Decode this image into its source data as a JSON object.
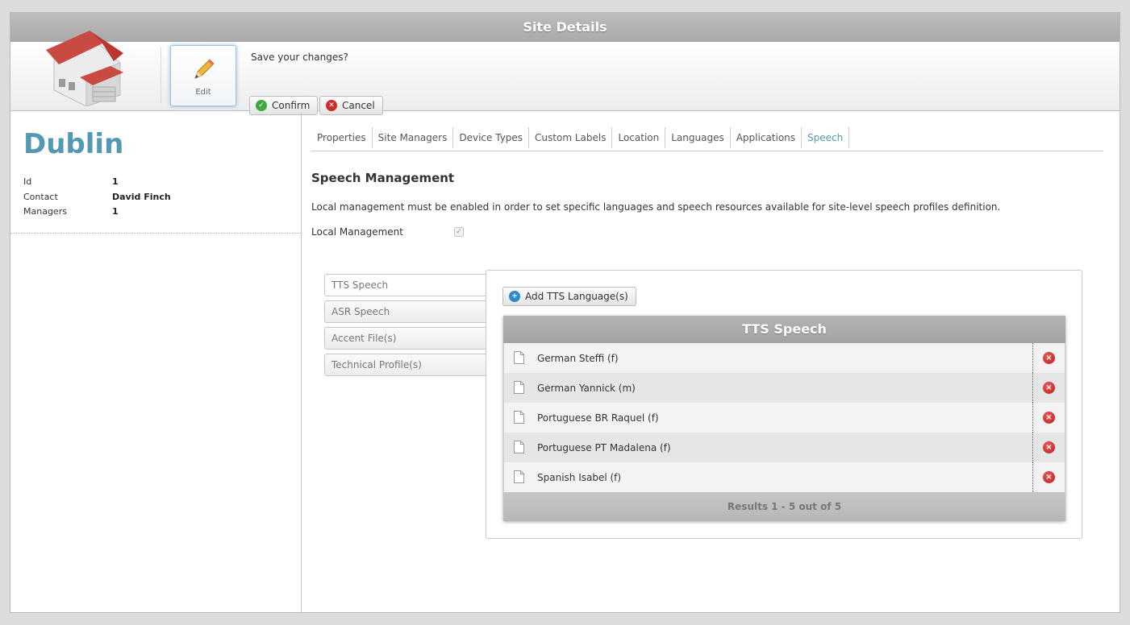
{
  "window": {
    "title": "Site Details"
  },
  "toolbar": {
    "edit_label": "Edit",
    "save_prompt": "Save your changes?",
    "confirm_label": "Confirm",
    "cancel_label": "Cancel"
  },
  "site": {
    "name": "Dublin",
    "fields": [
      {
        "label": "Id",
        "value": "1"
      },
      {
        "label": "Contact",
        "value": "David Finch"
      },
      {
        "label": "Managers",
        "value": "1"
      }
    ]
  },
  "tabs": [
    "Properties",
    "Site Managers",
    "Device Types",
    "Custom Labels",
    "Location",
    "Languages",
    "Applications",
    "Speech"
  ],
  "active_tab": "Speech",
  "speech": {
    "title": "Speech Management",
    "description": "Local management must be enabled in order to set specific languages and speech resources available for site-level speech profiles definition.",
    "local_management_label": "Local Management",
    "local_management_checked": true,
    "side_tabs": [
      "TTS Speech",
      "ASR Speech",
      "Accent File(s)",
      "Technical Profile(s)"
    ],
    "active_side_tab": "TTS Speech",
    "add_button_label": "Add TTS Language(s)",
    "grid": {
      "title": "TTS Speech",
      "rows": [
        "German Steffi (f)",
        "German Yannick (m)",
        "Portuguese BR Raquel (f)",
        "Portuguese PT Madalena (f)",
        "Spanish Isabel (f)"
      ],
      "footer": "Results 1 - 5 out of 5"
    }
  },
  "colors": {
    "accent": "#5499b3",
    "header": "#aaaaaa",
    "delete": "#cc2b2b",
    "confirm": "#3cab3c",
    "add": "#2f8acb"
  },
  "icons": {
    "site": "warehouse-icon",
    "edit": "pencil-icon",
    "confirm": "check-circle-icon",
    "cancel": "x-circle-icon",
    "add": "plus-circle-icon",
    "row": "document-icon",
    "delete": "delete-circle-icon"
  }
}
